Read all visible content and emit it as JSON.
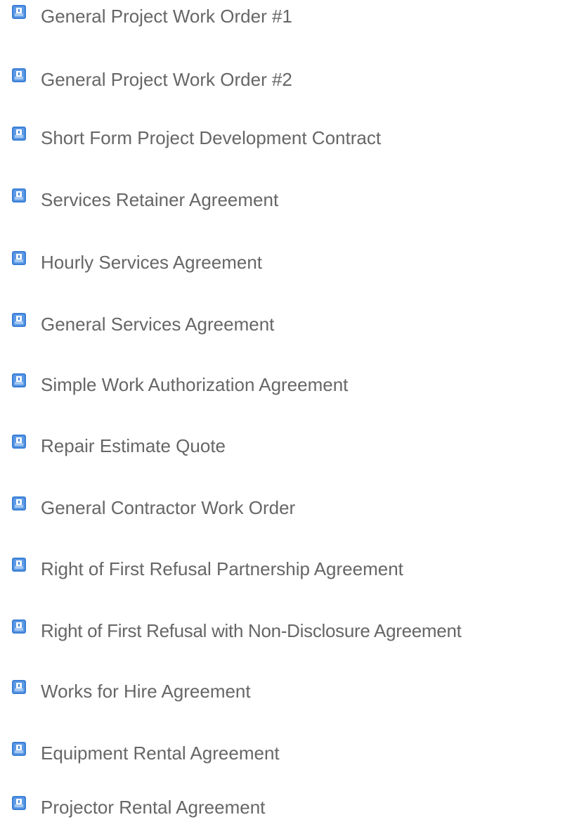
{
  "document_list": {
    "icon": "document-template-icon",
    "accent_color": "#3b7fd6",
    "items": [
      {
        "label": "General Project Work Order #1"
      },
      {
        "label": "General Project Work Order #2"
      },
      {
        "label": "Short Form Project Development Contract"
      },
      {
        "label": "Services Retainer Agreement"
      },
      {
        "label": "Hourly Services Agreement"
      },
      {
        "label": "General Services Agreement"
      },
      {
        "label": "Simple Work Authorization Agreement"
      },
      {
        "label": "Repair Estimate Quote"
      },
      {
        "label": "General Contractor Work Order"
      },
      {
        "label": "Right of First Refusal Partnership Agreement"
      },
      {
        "label": "Right of First Refusal with Non-Disclosure Agreement"
      },
      {
        "label": "Works for Hire Agreement"
      },
      {
        "label": "Equipment Rental Agreement"
      },
      {
        "label": "Projector Rental Agreement"
      }
    ]
  }
}
